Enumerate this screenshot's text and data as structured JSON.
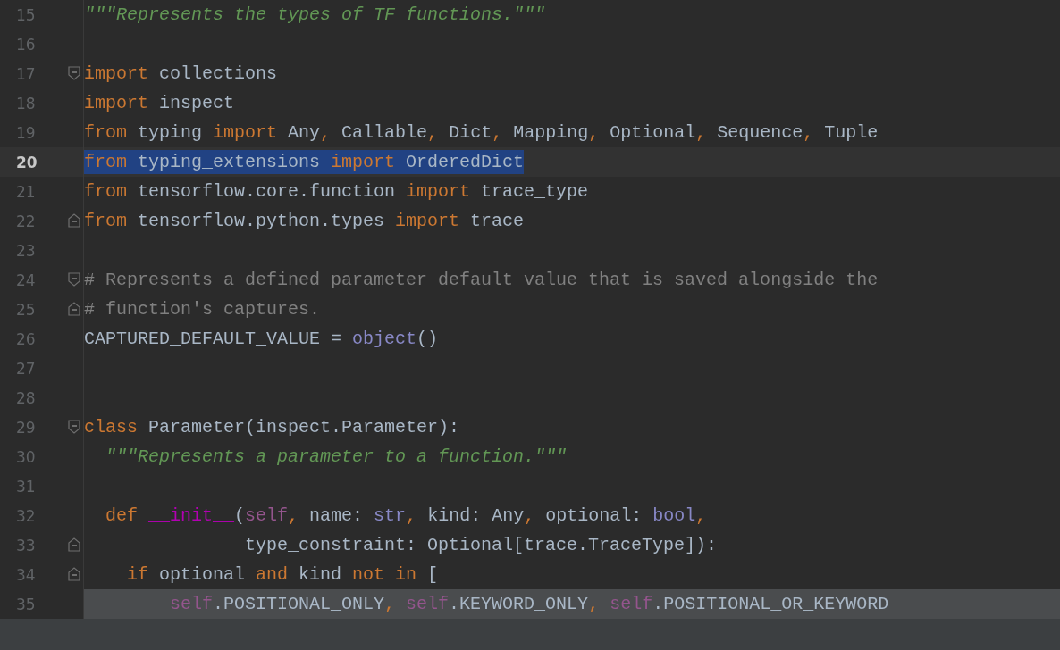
{
  "editor": {
    "lines": [
      {
        "number": "15",
        "current": false,
        "selected": false,
        "highlighted": false,
        "fold_open": false,
        "fold_close": false,
        "tokens": [
          {
            "kind": "doc",
            "text": "\"\"\"Represents the types of TF functions.\"\"\""
          }
        ]
      },
      {
        "number": "16",
        "current": false,
        "selected": false,
        "highlighted": false,
        "fold_open": false,
        "fold_close": false
      },
      {
        "number": "17",
        "current": false,
        "selected": false,
        "highlighted": false,
        "fold_open": true,
        "fold_close": false,
        "tokens": [
          {
            "kind": "kw",
            "text": "import"
          },
          {
            "kind": "plain",
            "text": " collections"
          }
        ]
      },
      {
        "number": "18",
        "current": false,
        "selected": false,
        "highlighted": false,
        "fold_open": false,
        "fold_close": false,
        "tokens": [
          {
            "kind": "kw",
            "text": "import"
          },
          {
            "kind": "plain",
            "text": " inspect"
          }
        ]
      },
      {
        "number": "19",
        "current": false,
        "selected": false,
        "highlighted": false,
        "fold_open": false,
        "fold_close": false,
        "tokens": [
          {
            "kind": "kw",
            "text": "from"
          },
          {
            "kind": "plain",
            "text": " typing "
          },
          {
            "kind": "kw",
            "text": "import"
          },
          {
            "kind": "plain",
            "text": " Any"
          },
          {
            "kind": "kw",
            "text": ","
          },
          {
            "kind": "plain",
            "text": " Callable"
          },
          {
            "kind": "kw",
            "text": ","
          },
          {
            "kind": "plain",
            "text": " Dict"
          },
          {
            "kind": "kw",
            "text": ","
          },
          {
            "kind": "plain",
            "text": " Mapping"
          },
          {
            "kind": "kw",
            "text": ","
          },
          {
            "kind": "plain",
            "text": " Optional"
          },
          {
            "kind": "kw",
            "text": ","
          },
          {
            "kind": "plain",
            "text": " Sequence"
          },
          {
            "kind": "kw",
            "text": ","
          },
          {
            "kind": "plain",
            "text": " Tuple"
          }
        ]
      },
      {
        "number": "20",
        "current": true,
        "selected": true,
        "highlighted": false,
        "fold_open": false,
        "fold_close": false,
        "tokens": [
          {
            "kind": "kw",
            "text": "from"
          },
          {
            "kind": "plain",
            "text": " typing_extensions "
          },
          {
            "kind": "kw",
            "text": "import"
          },
          {
            "kind": "plain",
            "text": " OrderedDict"
          }
        ]
      },
      {
        "number": "21",
        "current": false,
        "selected": false,
        "highlighted": false,
        "fold_open": false,
        "fold_close": false,
        "tokens": [
          {
            "kind": "kw",
            "text": "from"
          },
          {
            "kind": "plain",
            "text": " tensorflow.core.function "
          },
          {
            "kind": "kw",
            "text": "import"
          },
          {
            "kind": "plain",
            "text": " trace_type"
          }
        ]
      },
      {
        "number": "22",
        "current": false,
        "selected": false,
        "highlighted": false,
        "fold_open": false,
        "fold_close": true,
        "tokens": [
          {
            "kind": "kw",
            "text": "from"
          },
          {
            "kind": "plain",
            "text": " tensorflow.python.types "
          },
          {
            "kind": "kw",
            "text": "import"
          },
          {
            "kind": "plain",
            "text": " trace"
          }
        ]
      },
      {
        "number": "23",
        "current": false,
        "selected": false,
        "highlighted": false,
        "fold_open": false,
        "fold_close": false
      },
      {
        "number": "24",
        "current": false,
        "selected": false,
        "highlighted": false,
        "fold_open": true,
        "fold_close": false,
        "tokens": [
          {
            "kind": "comment",
            "text": "# Represents a defined parameter default value that is saved alongside the"
          }
        ]
      },
      {
        "number": "25",
        "current": false,
        "selected": false,
        "highlighted": false,
        "fold_open": false,
        "fold_close": true,
        "tokens": [
          {
            "kind": "comment",
            "text": "# function's captures."
          }
        ]
      },
      {
        "number": "26",
        "current": false,
        "selected": false,
        "highlighted": false,
        "fold_open": false,
        "fold_close": false,
        "tokens": [
          {
            "kind": "plain",
            "text": "CAPTURED_DEFAULT_VALUE = "
          },
          {
            "kind": "builtin",
            "text": "object"
          },
          {
            "kind": "plain",
            "text": "()"
          }
        ]
      },
      {
        "number": "27",
        "current": false,
        "selected": false,
        "highlighted": false,
        "fold_open": false,
        "fold_close": false
      },
      {
        "number": "28",
        "current": false,
        "selected": false,
        "highlighted": false,
        "fold_open": false,
        "fold_close": false
      },
      {
        "number": "29",
        "current": false,
        "selected": false,
        "highlighted": false,
        "fold_open": true,
        "fold_close": false,
        "tokens": [
          {
            "kind": "kw",
            "text": "class"
          },
          {
            "kind": "plain",
            "text": " Parameter(inspect.Parameter):"
          }
        ]
      },
      {
        "number": "30",
        "current": false,
        "selected": false,
        "highlighted": false,
        "fold_open": false,
        "fold_close": false,
        "tokens": [
          {
            "kind": "doc",
            "text": "  \"\"\"Represents a parameter to a function.\"\"\""
          }
        ]
      },
      {
        "number": "31",
        "current": false,
        "selected": false,
        "highlighted": false,
        "fold_open": false,
        "fold_close": false
      },
      {
        "number": "32",
        "current": false,
        "selected": false,
        "highlighted": false,
        "fold_open": false,
        "fold_close": false,
        "tokens": [
          {
            "kind": "kw",
            "text": "  def "
          },
          {
            "kind": "magic",
            "text": "__init__"
          },
          {
            "kind": "plain",
            "text": "("
          },
          {
            "kind": "self",
            "text": "self"
          },
          {
            "kind": "kw",
            "text": ","
          },
          {
            "kind": "plain",
            "text": " name: "
          },
          {
            "kind": "builtin",
            "text": "str"
          },
          {
            "kind": "kw",
            "text": ","
          },
          {
            "kind": "plain",
            "text": " kind: Any"
          },
          {
            "kind": "kw",
            "text": ","
          },
          {
            "kind": "plain",
            "text": " optional: "
          },
          {
            "kind": "builtin",
            "text": "bool"
          },
          {
            "kind": "kw",
            "text": ","
          }
        ]
      },
      {
        "number": "33",
        "current": false,
        "selected": false,
        "highlighted": false,
        "fold_open": false,
        "fold_close": true,
        "tokens": [
          {
            "kind": "plain",
            "text": "               type_constraint: Optional[trace.TraceType]):"
          }
        ]
      },
      {
        "number": "34",
        "current": false,
        "selected": false,
        "highlighted": false,
        "fold_open": false,
        "fold_close": true,
        "tokens": [
          {
            "kind": "kw",
            "text": "    if"
          },
          {
            "kind": "plain",
            "text": " optional "
          },
          {
            "kind": "kw",
            "text": "and"
          },
          {
            "kind": "plain",
            "text": " kind "
          },
          {
            "kind": "kw",
            "text": "not in"
          },
          {
            "kind": "plain",
            "text": " ["
          }
        ]
      },
      {
        "number": "35",
        "current": false,
        "selected": false,
        "highlighted": true,
        "fold_open": false,
        "fold_close": false,
        "tokens": [
          {
            "kind": "self",
            "text": "        self"
          },
          {
            "kind": "plain",
            "text": ".POSITIONAL_ONLY"
          },
          {
            "kind": "kw",
            "text": ", "
          },
          {
            "kind": "self",
            "text": "self"
          },
          {
            "kind": "plain",
            "text": ".KEYWORD_ONLY"
          },
          {
            "kind": "kw",
            "text": ", "
          },
          {
            "kind": "self",
            "text": "self"
          },
          {
            "kind": "plain",
            "text": ".POSITIONAL_OR_KEYWORD"
          }
        ]
      }
    ]
  }
}
